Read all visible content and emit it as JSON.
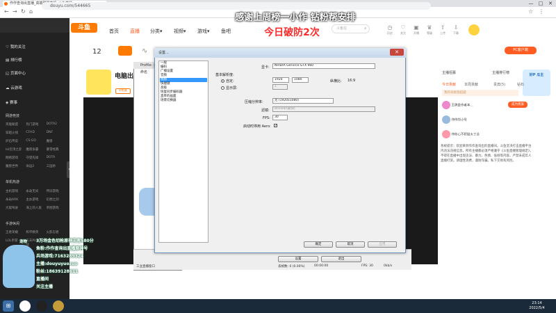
{
  "browser": {
    "tab_title": "作作查询出直播_高端联盟直播_斗鱼直播",
    "url": "douyu.com/544665",
    "window_controls": [
      "—",
      "□",
      "✕"
    ]
  },
  "banners": {
    "top": "感谢上周榜一小作  钻粉帮安排",
    "sub": "今日破防2次"
  },
  "header": {
    "logo": "斗鱼",
    "nav": [
      "首页",
      "直播",
      "分类▾",
      "视频▾",
      "游戏▾",
      "鱼吧"
    ],
    "active_nav": "直播",
    "search_placeholder": "斗鱼在",
    "icons": [
      {
        "name": "history-icon",
        "label": "历史"
      },
      {
        "name": "follow-icon",
        "label": "关注"
      },
      {
        "name": "open-live-icon",
        "label": "开播"
      },
      {
        "name": "level-icon",
        "label": "等级"
      },
      {
        "name": "upload-icon",
        "label": "上传"
      },
      {
        "name": "download-icon",
        "label": "下载"
      }
    ]
  },
  "sidebar": {
    "items": [
      "我的关注",
      "排行榜",
      "页面中心",
      "云游戏",
      "赛事"
    ],
    "section1": "网游竞技",
    "section1_games": [
      "英雄联盟",
      "热门游戏",
      "DOTA2",
      "穿越火线",
      "CFHD",
      "DNF",
      "炉石传说",
      "CS:GO",
      "魔兽",
      "lol云顶之弈",
      "魔兽争霸",
      "暴雪经典",
      "网络游戏",
      "守望先锋",
      "DOTA",
      "魔兽世界",
      "命运2",
      "三国杀"
    ],
    "section2": "单机热游",
    "section2_games": [
      "主机游戏",
      "永劫无间",
      "怀旧游戏",
      "永劫ARK",
      "主办游戏",
      "幻想之剑",
      "大观驾驶",
      "海上的人族",
      "单图游戏"
    ],
    "section3": "手游休闲",
    "section3_games": [
      "王者荣耀",
      "和平精英",
      "火影忍者",
      "LOL手游",
      "天天PUBG之战",
      "DOTA手游"
    ]
  },
  "main": {
    "category_count": "12",
    "room_title": "电脑出",
    "vip_badge": "V贵族"
  },
  "right_panel": {
    "tabs": [
      "今日贡献",
      "本周贡献",
      "贵宾(5)",
      "钻石"
    ],
    "top_label": "主播招募",
    "rank_entry": "主播排行榜",
    "ranking_note": "我的贡献值超越",
    "fans": [
      "王牌是作者本...",
      "作作的小号",
      "作你心不积极大了没"
    ],
    "pc_badge": "PC客户端",
    "system_notice": "系统提示：欢迎来到作作查询出的直播间。斗鱼坚决打击直播平台内违法违规信息，所有主播都必须严格遵守《斗鱼直播管理规定》，不得在直播中出现违法、暴力、色情、低俗等内容。严禁未成年人直播打赏。请理性消费，谨防诈骗，私下交易有风险。",
    "game_badge": "好P 瓜主",
    "become_label": "成为贵族"
  },
  "obs": {
    "title": "Profile: 未命名 - 场景: 未命名",
    "status": "工业直播窗口",
    "start_btn": "设置",
    "exit_btn": "退出",
    "dropped": "丢帧数: 0 (0.00%)",
    "fps": "FPS: 30",
    "bitrate": "0kb/s",
    "time": "00:00:00"
  },
  "dialog": {
    "title": "设置...",
    "list": [
      "一般",
      "编码",
      "广播设置",
      "音频",
      "视频",
      "快捷键",
      "高级",
      "恢复同步编码器",
      "直率的画面",
      "场景切换器"
    ],
    "selected": "视频",
    "adapter_label": "显卡:",
    "adapter_value": "NVIDIA GeForce GTX 960",
    "base_res_label": "基本解析度:",
    "custom_label": "自定:",
    "custom_w": "1920",
    "custom_h": "1080",
    "monitor_label": "显示屏:",
    "monitor_value": "1",
    "aspect_label": "纵横比:",
    "aspect_value": "16:9",
    "downscale_label": "压缩分辨率:",
    "downscale_value": "无 (1920x1080)",
    "filter_label": "滤镜:",
    "filter_value": "Bilinear(最快)",
    "fps_label": "FPS:",
    "fps_value": "30",
    "aero_label": "启动时停用 Aero:",
    "aero_checked": true,
    "ok": "确定",
    "cancel": "取消",
    "apply": "应用"
  },
  "stream_overlay": {
    "label": "宠物",
    "line1": "3万场金色切枪原神王者580分",
    "line2": "鱼粉:作作查询出直播原神号",
    "line3": "兵场游戏:7163289324",
    "line4": "主播:douyuyuozuo",
    "line5": "粉丝:18639128611",
    "line6": "直播间",
    "line7": "关注主播"
  },
  "taskbar": {
    "time": "23:14",
    "date": "2022/5/4"
  }
}
